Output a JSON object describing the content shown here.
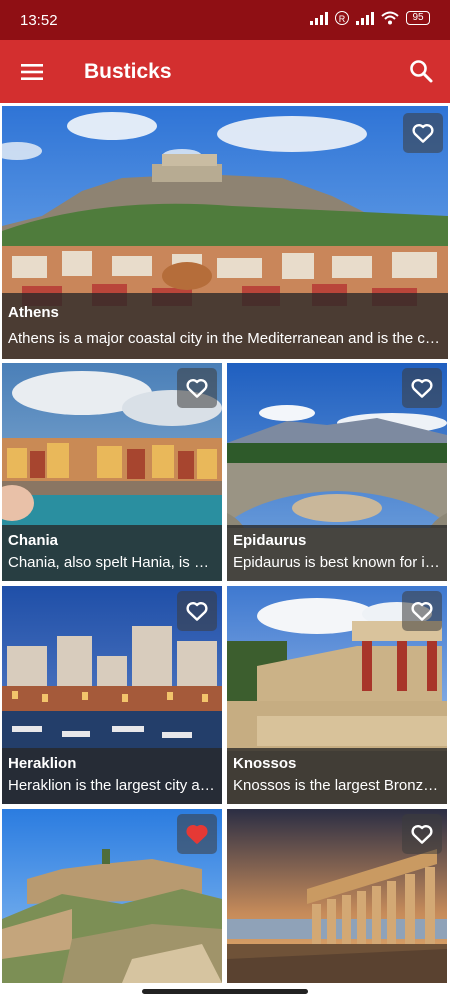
{
  "status_bar": {
    "time": "13:52",
    "battery": "95"
  },
  "app_bar": {
    "title": "Busticks",
    "menu_icon": "menu-icon",
    "search_icon": "search-icon"
  },
  "places": [
    {
      "name": "Athens",
      "description": "Athens is a major coastal city in the Mediterranean and is the capital of Greece.",
      "favorite": false
    },
    {
      "name": "Chania",
      "description": "Chania, also spelt Hania, is a city on the northwest coast of Crete.",
      "favorite": false
    },
    {
      "name": "Epidaurus",
      "description": "Epidaurus is best known for its well-preserved theatre.",
      "favorite": false
    },
    {
      "name": "Heraklion",
      "description": "Heraklion is the largest city and the administrative capital of Crete.",
      "favorite": false
    },
    {
      "name": "Knossos",
      "description": "Knossos is the largest Bronze Age archaeological site on Crete.",
      "favorite": false
    },
    {
      "name": "",
      "description": "",
      "favorite": true
    },
    {
      "name": "",
      "description": "",
      "favorite": false
    }
  ],
  "colors": {
    "status_bar": "#8f0f14",
    "app_bar": "#d32f2f",
    "favorite_active": "#e53935"
  }
}
